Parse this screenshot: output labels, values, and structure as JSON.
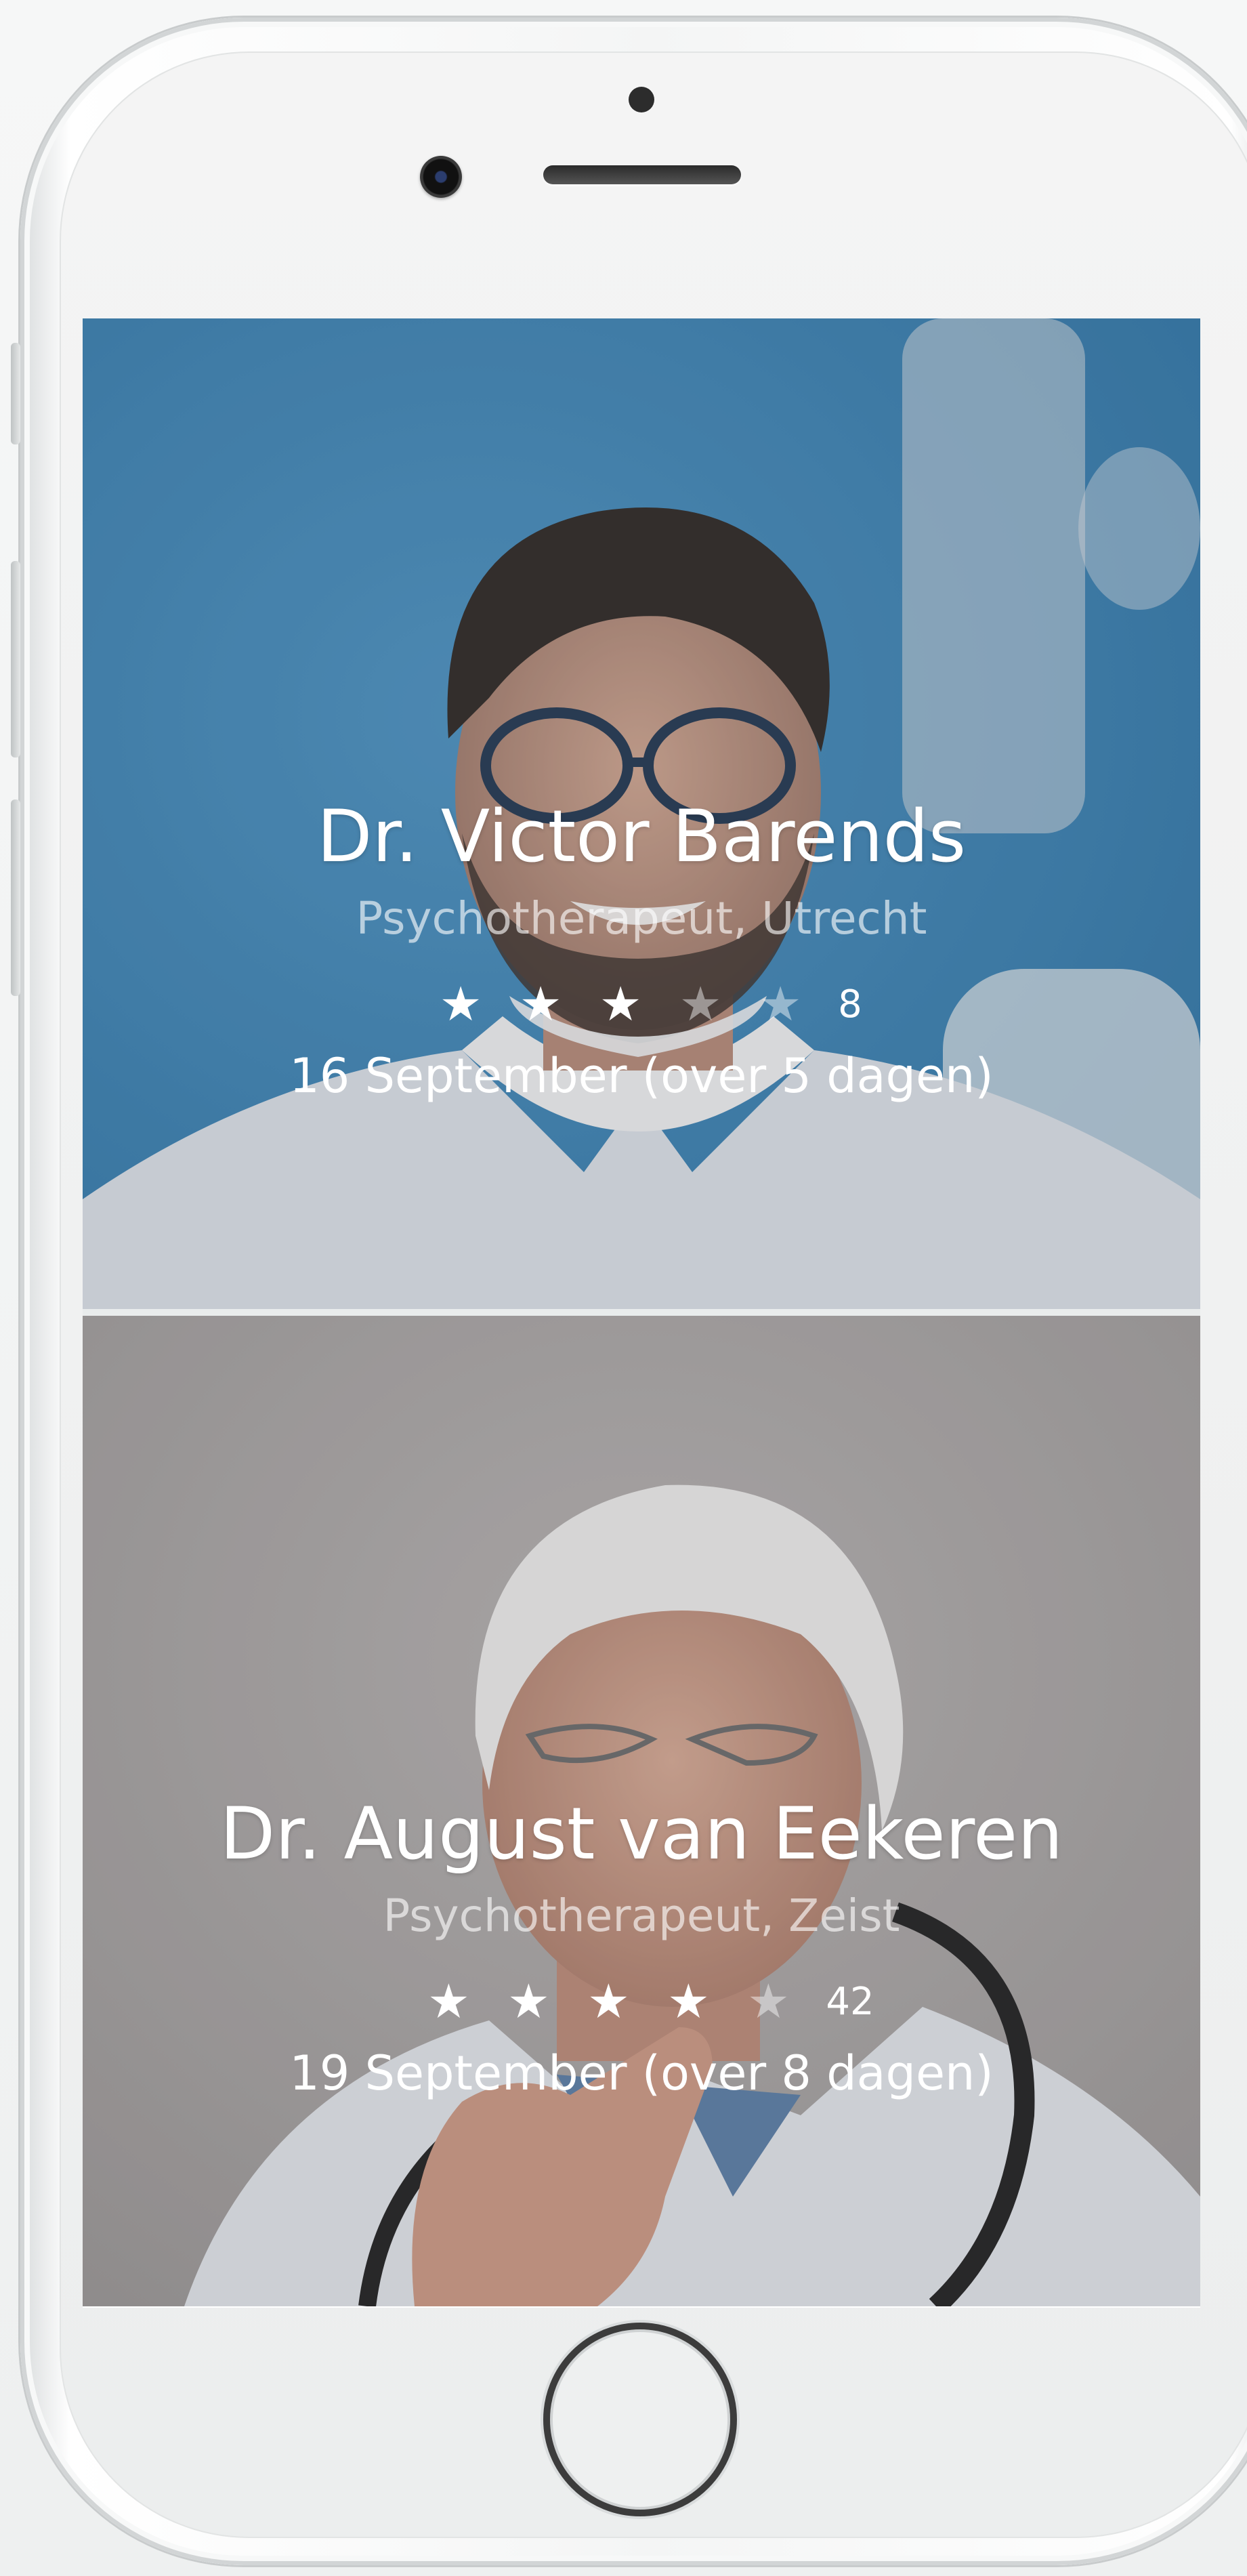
{
  "doctors": [
    {
      "name": "Dr. Victor Barends",
      "subtitle": "Psychotherapeut, Utrecht",
      "rating": 3,
      "max_rating": 5,
      "review_count": "8",
      "next_date": "16 September (over 5 dagen)"
    },
    {
      "name": "Dr. August van Eekeren",
      "subtitle": "Psychotherapeut, Zeist",
      "rating": 4,
      "max_rating": 5,
      "review_count": "42",
      "next_date": "19 September (over 8 dagen)"
    }
  ],
  "icons": {
    "star": "★"
  },
  "colors": {
    "card1_background": "#3d85b4",
    "card2_background": "#aeaaa9",
    "text": "#ffffff"
  }
}
